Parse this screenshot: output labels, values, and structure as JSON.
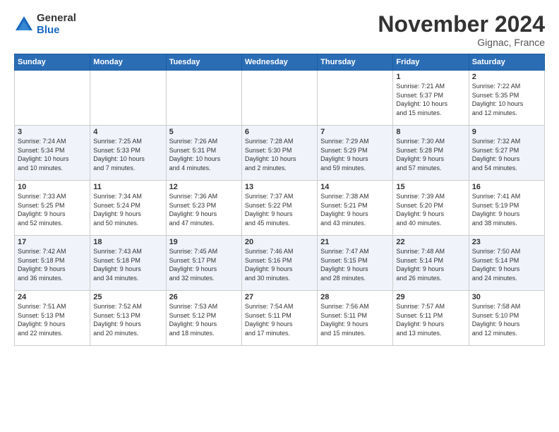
{
  "logo": {
    "general": "General",
    "blue": "Blue"
  },
  "title": "November 2024",
  "location": "Gignac, France",
  "days_header": [
    "Sunday",
    "Monday",
    "Tuesday",
    "Wednesday",
    "Thursday",
    "Friday",
    "Saturday"
  ],
  "weeks": [
    [
      {
        "num": "",
        "info": ""
      },
      {
        "num": "",
        "info": ""
      },
      {
        "num": "",
        "info": ""
      },
      {
        "num": "",
        "info": ""
      },
      {
        "num": "",
        "info": ""
      },
      {
        "num": "1",
        "info": "Sunrise: 7:21 AM\nSunset: 5:37 PM\nDaylight: 10 hours\nand 15 minutes."
      },
      {
        "num": "2",
        "info": "Sunrise: 7:22 AM\nSunset: 5:35 PM\nDaylight: 10 hours\nand 12 minutes."
      }
    ],
    [
      {
        "num": "3",
        "info": "Sunrise: 7:24 AM\nSunset: 5:34 PM\nDaylight: 10 hours\nand 10 minutes."
      },
      {
        "num": "4",
        "info": "Sunrise: 7:25 AM\nSunset: 5:33 PM\nDaylight: 10 hours\nand 7 minutes."
      },
      {
        "num": "5",
        "info": "Sunrise: 7:26 AM\nSunset: 5:31 PM\nDaylight: 10 hours\nand 4 minutes."
      },
      {
        "num": "6",
        "info": "Sunrise: 7:28 AM\nSunset: 5:30 PM\nDaylight: 10 hours\nand 2 minutes."
      },
      {
        "num": "7",
        "info": "Sunrise: 7:29 AM\nSunset: 5:29 PM\nDaylight: 9 hours\nand 59 minutes."
      },
      {
        "num": "8",
        "info": "Sunrise: 7:30 AM\nSunset: 5:28 PM\nDaylight: 9 hours\nand 57 minutes."
      },
      {
        "num": "9",
        "info": "Sunrise: 7:32 AM\nSunset: 5:27 PM\nDaylight: 9 hours\nand 54 minutes."
      }
    ],
    [
      {
        "num": "10",
        "info": "Sunrise: 7:33 AM\nSunset: 5:25 PM\nDaylight: 9 hours\nand 52 minutes."
      },
      {
        "num": "11",
        "info": "Sunrise: 7:34 AM\nSunset: 5:24 PM\nDaylight: 9 hours\nand 50 minutes."
      },
      {
        "num": "12",
        "info": "Sunrise: 7:36 AM\nSunset: 5:23 PM\nDaylight: 9 hours\nand 47 minutes."
      },
      {
        "num": "13",
        "info": "Sunrise: 7:37 AM\nSunset: 5:22 PM\nDaylight: 9 hours\nand 45 minutes."
      },
      {
        "num": "14",
        "info": "Sunrise: 7:38 AM\nSunset: 5:21 PM\nDaylight: 9 hours\nand 43 minutes."
      },
      {
        "num": "15",
        "info": "Sunrise: 7:39 AM\nSunset: 5:20 PM\nDaylight: 9 hours\nand 40 minutes."
      },
      {
        "num": "16",
        "info": "Sunrise: 7:41 AM\nSunset: 5:19 PM\nDaylight: 9 hours\nand 38 minutes."
      }
    ],
    [
      {
        "num": "17",
        "info": "Sunrise: 7:42 AM\nSunset: 5:18 PM\nDaylight: 9 hours\nand 36 minutes."
      },
      {
        "num": "18",
        "info": "Sunrise: 7:43 AM\nSunset: 5:18 PM\nDaylight: 9 hours\nand 34 minutes."
      },
      {
        "num": "19",
        "info": "Sunrise: 7:45 AM\nSunset: 5:17 PM\nDaylight: 9 hours\nand 32 minutes."
      },
      {
        "num": "20",
        "info": "Sunrise: 7:46 AM\nSunset: 5:16 PM\nDaylight: 9 hours\nand 30 minutes."
      },
      {
        "num": "21",
        "info": "Sunrise: 7:47 AM\nSunset: 5:15 PM\nDaylight: 9 hours\nand 28 minutes."
      },
      {
        "num": "22",
        "info": "Sunrise: 7:48 AM\nSunset: 5:14 PM\nDaylight: 9 hours\nand 26 minutes."
      },
      {
        "num": "23",
        "info": "Sunrise: 7:50 AM\nSunset: 5:14 PM\nDaylight: 9 hours\nand 24 minutes."
      }
    ],
    [
      {
        "num": "24",
        "info": "Sunrise: 7:51 AM\nSunset: 5:13 PM\nDaylight: 9 hours\nand 22 minutes."
      },
      {
        "num": "25",
        "info": "Sunrise: 7:52 AM\nSunset: 5:13 PM\nDaylight: 9 hours\nand 20 minutes."
      },
      {
        "num": "26",
        "info": "Sunrise: 7:53 AM\nSunset: 5:12 PM\nDaylight: 9 hours\nand 18 minutes."
      },
      {
        "num": "27",
        "info": "Sunrise: 7:54 AM\nSunset: 5:11 PM\nDaylight: 9 hours\nand 17 minutes."
      },
      {
        "num": "28",
        "info": "Sunrise: 7:56 AM\nSunset: 5:11 PM\nDaylight: 9 hours\nand 15 minutes."
      },
      {
        "num": "29",
        "info": "Sunrise: 7:57 AM\nSunset: 5:11 PM\nDaylight: 9 hours\nand 13 minutes."
      },
      {
        "num": "30",
        "info": "Sunrise: 7:58 AM\nSunset: 5:10 PM\nDaylight: 9 hours\nand 12 minutes."
      }
    ]
  ]
}
